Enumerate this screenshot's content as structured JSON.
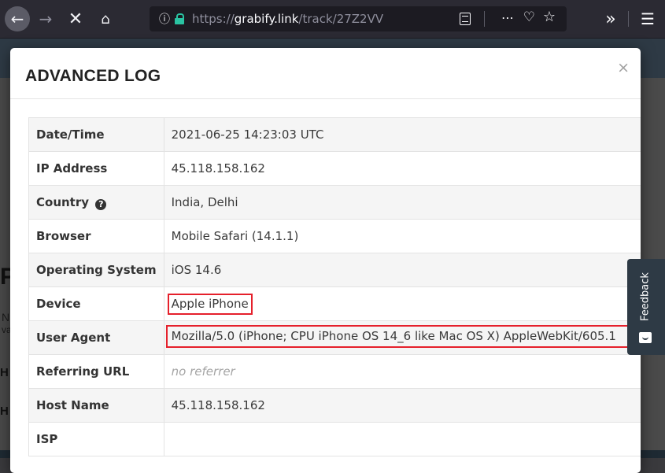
{
  "browser": {
    "url_prefix": "https://",
    "url_host": "grabify.link",
    "url_path": "/track/27Z2VV"
  },
  "modal": {
    "title": "ADVANCED LOG",
    "close_label": "×"
  },
  "log": {
    "rows": [
      {
        "label": "Date/Time",
        "value": "2021-06-25 14:23:03 UTC"
      },
      {
        "label": "IP Address",
        "value": "45.118.158.162"
      },
      {
        "label": "Country",
        "value": "India, Delhi"
      },
      {
        "label": "Browser",
        "value": "Mobile Safari (14.1.1)"
      },
      {
        "label": "Operating System",
        "value": "iOS 14.6"
      },
      {
        "label": "Device",
        "value": "Apple iPhone"
      },
      {
        "label": "User Agent",
        "value": "Mozilla/5.0 (iPhone; CPU iPhone OS 14_6 like Mac OS X) AppleWebKit/605.1"
      },
      {
        "label": "Referring URL",
        "value": "no referrer"
      },
      {
        "label": "Host Name",
        "value": "45.118.158.162"
      },
      {
        "label": "ISP",
        "value": ""
      }
    ]
  },
  "feedback": {
    "label": "Feedback"
  },
  "background_page": {
    "peek_a": "P",
    "peek_b": "N",
    "peek_c": "va",
    "peek_d": "H",
    "peek_e": "H"
  },
  "colors": {
    "highlight_border": "#e5202b",
    "toolbar_bg": "#2b2a33",
    "feedback_bg": "#2e3a45"
  },
  "icons": [
    "back-arrow-icon",
    "forward-arrow-icon",
    "stop-icon",
    "home-icon",
    "info-icon",
    "lock-icon",
    "reader-view-icon",
    "more-icon",
    "pocket-icon",
    "bookmark-star-icon",
    "overflow-chevron-icon",
    "hamburger-menu-icon",
    "question-circle-icon",
    "close-icon",
    "feedback-smile-icon"
  ]
}
